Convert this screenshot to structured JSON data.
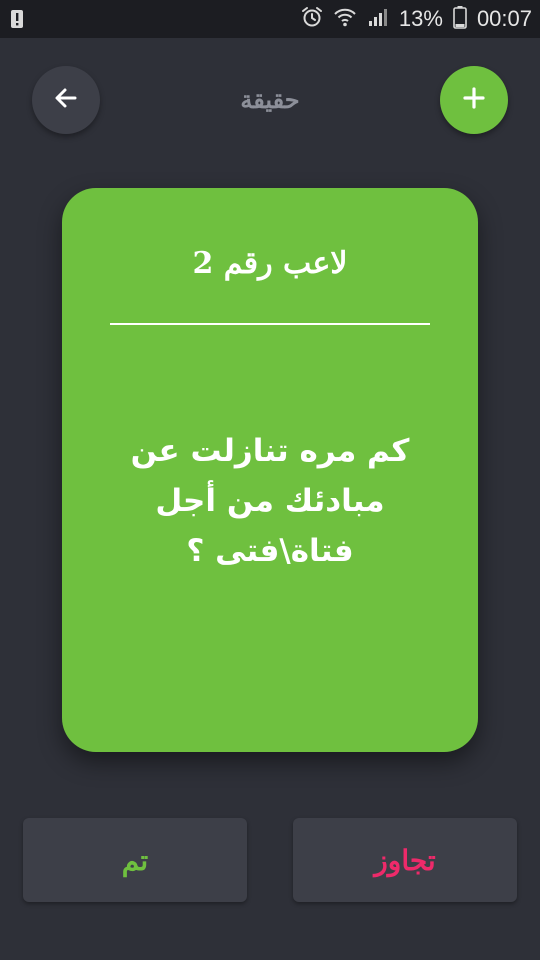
{
  "status_bar": {
    "battery_percent": "13%",
    "time": "00:07",
    "left_icon": "alert-icon",
    "icons": [
      "alarm-icon",
      "wifi-icon",
      "signal-icon",
      "battery-icon"
    ]
  },
  "header": {
    "title": "حقيقة",
    "back_icon": "arrow-left-icon",
    "add_icon": "plus-icon"
  },
  "card": {
    "player_label": "لاعب رقم 2",
    "question": "كم مره تنازلت عن مبادئك من أجل فتاة\\فتى ؟"
  },
  "actions": {
    "done_label": "تم",
    "skip_label": "تجاوز"
  },
  "colors": {
    "background": "#2e3038",
    "status_bar": "#1c1d22",
    "accent_green": "#6fc03f",
    "skip_pink": "#ee2a6a",
    "button_dark": "#3d3f48",
    "title_gray": "#8c8f99"
  }
}
